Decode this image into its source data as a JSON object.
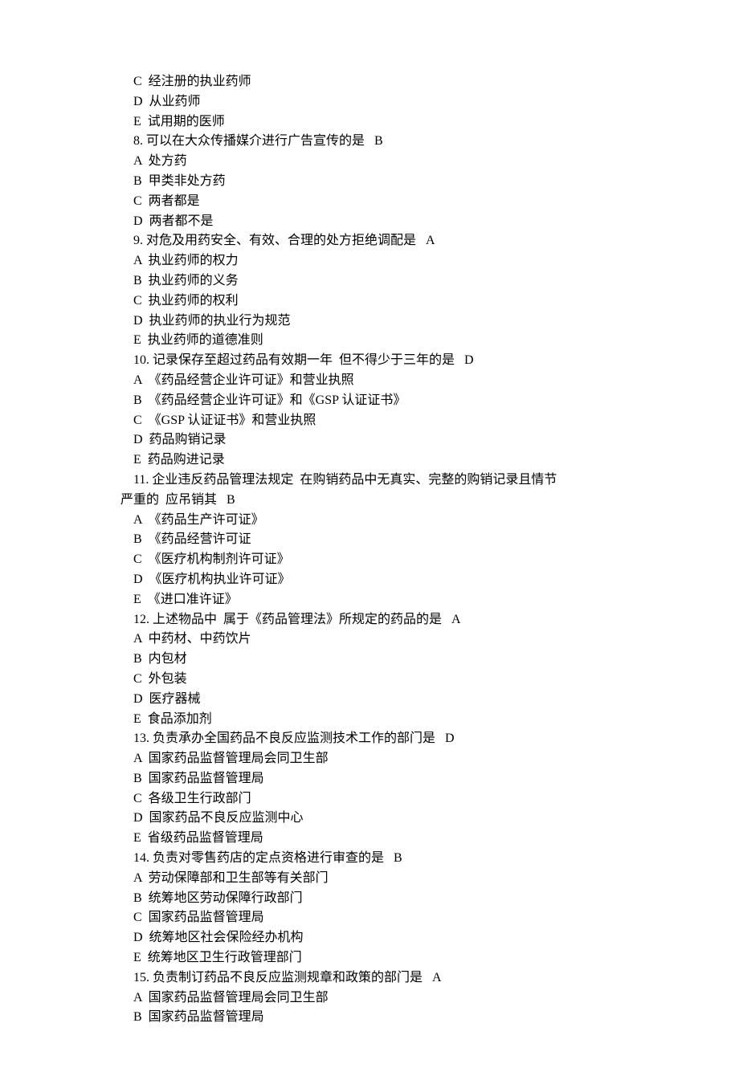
{
  "lines": [
    {
      "cls": "indent1",
      "text": "C  经注册的执业药师"
    },
    {
      "cls": "indent1",
      "text": "D  从业药师"
    },
    {
      "cls": "indent1",
      "text": "E  试用期的医师"
    },
    {
      "cls": "indent1",
      "text": "8. 可以在大众传播媒介进行广告宣传的是   B"
    },
    {
      "cls": "indent1",
      "text": "A  处方药"
    },
    {
      "cls": "indent1",
      "text": "B  甲类非处方药"
    },
    {
      "cls": "indent1",
      "text": "C  两者都是"
    },
    {
      "cls": "indent1",
      "text": "D  两者都不是"
    },
    {
      "cls": "indent1",
      "text": "9. 对危及用药安全、有效、合理的处方拒绝调配是   A"
    },
    {
      "cls": "indent1",
      "text": "A  执业药师的权力"
    },
    {
      "cls": "indent1",
      "text": "B  执业药师的义务"
    },
    {
      "cls": "indent1",
      "text": "C  执业药师的权利"
    },
    {
      "cls": "indent1",
      "text": "D  执业药师的执业行为规范"
    },
    {
      "cls": "indent1",
      "text": "E  执业药师的道德准则"
    },
    {
      "cls": "indent1",
      "text": "10. 记录保存至超过药品有效期一年  但不得少于三年的是   D"
    },
    {
      "cls": "indent1",
      "text": "A  《药品经营企业许可证》和营业执照"
    },
    {
      "cls": "indent1",
      "text": "B  《药品经营企业许可证》和《GSP 认证证书》"
    },
    {
      "cls": "indent1",
      "text": "C  《GSP 认证证书》和营业执照"
    },
    {
      "cls": "indent1",
      "text": "D  药品购销记录"
    },
    {
      "cls": "indent1",
      "text": "E  药品购进记录"
    },
    {
      "cls": "indent1",
      "text": "11. 企业违反药品管理法规定  在购销药品中无真实、完整的购销记录且情节"
    },
    {
      "cls": "cont",
      "text": "严重的  应吊销其   B"
    },
    {
      "cls": "indent1",
      "text": "A  《药品生产许可证》"
    },
    {
      "cls": "indent1",
      "text": "B  《药品经营许可证"
    },
    {
      "cls": "indent1",
      "text": "C  《医疗机构制剂许可证》"
    },
    {
      "cls": "indent1",
      "text": "D  《医疗机构执业许可证》"
    },
    {
      "cls": "indent1",
      "text": "E  《进口准许证》"
    },
    {
      "cls": "indent1",
      "text": "12. 上述物品中  属于《药品管理法》所规定的药品的是   A"
    },
    {
      "cls": "indent1",
      "text": "A  中药材、中药饮片"
    },
    {
      "cls": "indent1",
      "text": "B  内包材"
    },
    {
      "cls": "indent1",
      "text": "C  外包装"
    },
    {
      "cls": "indent1",
      "text": "D  医疗器械"
    },
    {
      "cls": "indent1",
      "text": "E  食品添加剂"
    },
    {
      "cls": "indent1",
      "text": "13. 负责承办全国药品不良反应监测技术工作的部门是   D"
    },
    {
      "cls": "indent1",
      "text": "A  国家药品监督管理局会同卫生部"
    },
    {
      "cls": "indent1",
      "text": "B  国家药品监督管理局"
    },
    {
      "cls": "indent1",
      "text": "C  各级卫生行政部门"
    },
    {
      "cls": "indent1",
      "text": "D  国家药品不良反应监测中心"
    },
    {
      "cls": "indent1",
      "text": "E  省级药品监督管理局"
    },
    {
      "cls": "indent1",
      "text": "14. 负责对零售药店的定点资格进行审查的是   B"
    },
    {
      "cls": "indent1",
      "text": "A  劳动保障部和卫生部等有关部门"
    },
    {
      "cls": "indent1",
      "text": "B  统筹地区劳动保障行政部门"
    },
    {
      "cls": "indent1",
      "text": "C  国家药品监督管理局"
    },
    {
      "cls": "indent1",
      "text": "D  统筹地区社会保险经办机构"
    },
    {
      "cls": "indent1",
      "text": "E  统筹地区卫生行政管理部门"
    },
    {
      "cls": "indent1",
      "text": "15. 负责制订药品不良反应监测规章和政策的部门是   A"
    },
    {
      "cls": "indent1",
      "text": "A  国家药品监督管理局会同卫生部"
    },
    {
      "cls": "indent1",
      "text": "B  国家药品监督管理局"
    }
  ]
}
